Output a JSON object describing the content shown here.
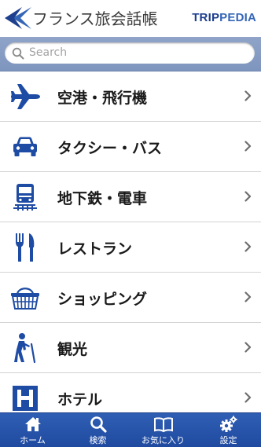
{
  "header": {
    "app_title": "フランス旅会話帳",
    "brand_part1": "TRIP",
    "brand_part2": "PEDIA"
  },
  "search": {
    "placeholder": "Search"
  },
  "menu": {
    "items": [
      {
        "label": "空港・飛行機",
        "icon": "airplane-icon"
      },
      {
        "label": "タクシー・バス",
        "icon": "car-icon"
      },
      {
        "label": "地下鉄・電車",
        "icon": "train-icon"
      },
      {
        "label": "レストラン",
        "icon": "fork-knife-icon"
      },
      {
        "label": "ショッピング",
        "icon": "basket-icon"
      },
      {
        "label": "観光",
        "icon": "hiker-icon"
      },
      {
        "label": "ホテル",
        "icon": "hotel-icon"
      }
    ]
  },
  "tabbar": {
    "tabs": [
      {
        "label": "ホーム",
        "icon": "home-icon"
      },
      {
        "label": "検索",
        "icon": "search-icon"
      },
      {
        "label": "お気に入り",
        "icon": "book-icon"
      },
      {
        "label": "設定",
        "icon": "gear-icon"
      }
    ]
  },
  "colors": {
    "icon_blue": "#1e4ba3",
    "tabbar_blue": "#2553aa",
    "search_bar": "#8699c2"
  }
}
